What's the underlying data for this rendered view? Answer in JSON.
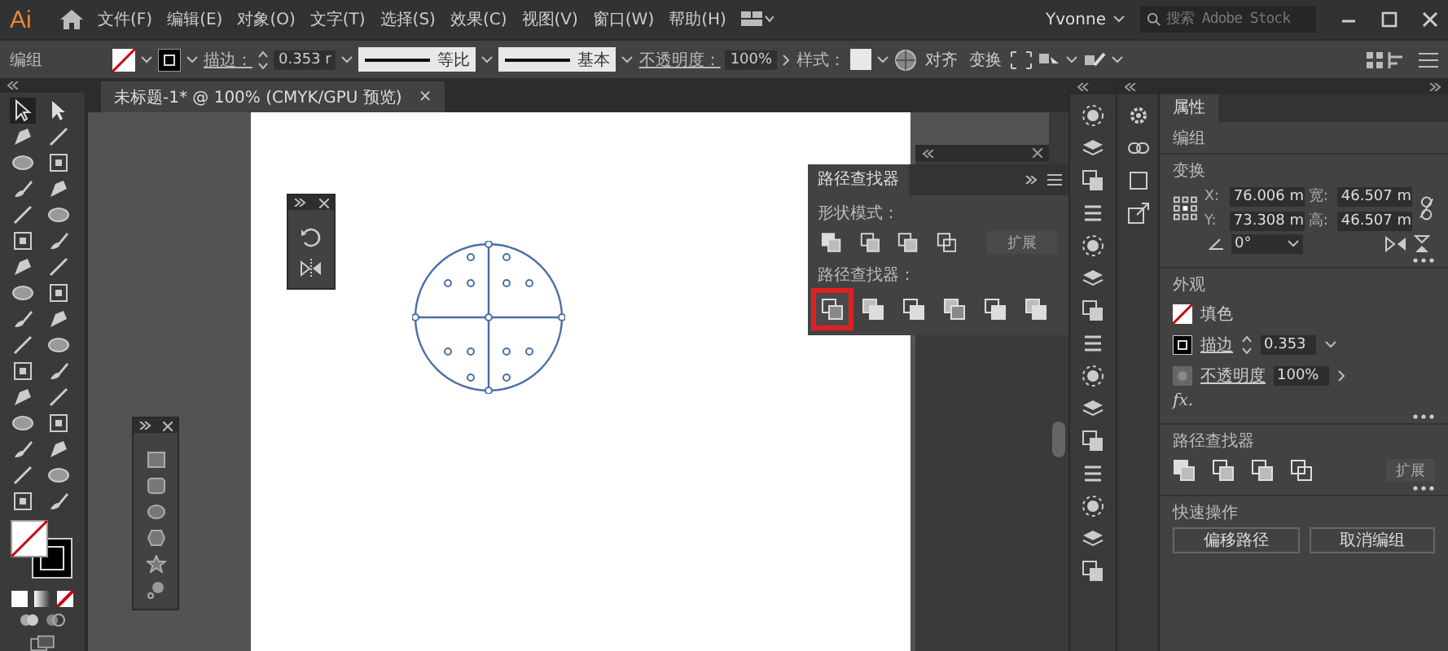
{
  "app": {
    "logo": "Ai"
  },
  "menu": [
    "文件(F)",
    "编辑(E)",
    "对象(O)",
    "文字(T)",
    "选择(S)",
    "效果(C)",
    "视图(V)",
    "窗口(W)",
    "帮助(H)"
  ],
  "user": "Yvonne",
  "search": {
    "placeholder": "搜索 Adobe Stock"
  },
  "control_bar": {
    "selection": "编组",
    "stroke_label": "描边：",
    "stroke_value": "0.353 r",
    "profile": "等比",
    "brush": "基本",
    "opacity_label": "不透明度：",
    "opacity": "100%",
    "style_label": "样式：",
    "buttons": [
      "对齐",
      "变换"
    ]
  },
  "document_tab": {
    "title": "未标题-1* @ 100% (CMYK/GPU 预览)",
    "close": "×"
  },
  "pathfinder": {
    "title": "路径查找器",
    "shape_modes_label": "形状模式：",
    "expand": "扩展",
    "pathfinders_label": "路径查找器：",
    "pathfinder_buttons": [
      {
        "highlighted": true
      },
      {
        "highlighted": false
      },
      {
        "highlighted": false
      },
      {
        "highlighted": false
      },
      {
        "highlighted": false
      },
      {
        "highlighted": false
      }
    ]
  },
  "properties": {
    "tab": "属性",
    "selection": "编组",
    "transform": {
      "title": "变换",
      "x_label": "X:",
      "x": "76.006 m",
      "y_label": "Y:",
      "y": "73.308 m",
      "w_label": "宽:",
      "w": "46.507 m",
      "h_label": "高:",
      "h": "46.507 m",
      "angle": "0°"
    },
    "appearance": {
      "title": "外观",
      "fill": "填色",
      "stroke": "描边",
      "stroke_value": "0.353",
      "opacity": "不透明度",
      "opacity_value": "100%",
      "fx": "fx."
    },
    "pathfinder": {
      "title": "路径查找器",
      "expand": "扩展"
    },
    "quick_actions": {
      "title": "快速操作",
      "buttons": [
        "偏移路径",
        "取消编组"
      ]
    }
  }
}
